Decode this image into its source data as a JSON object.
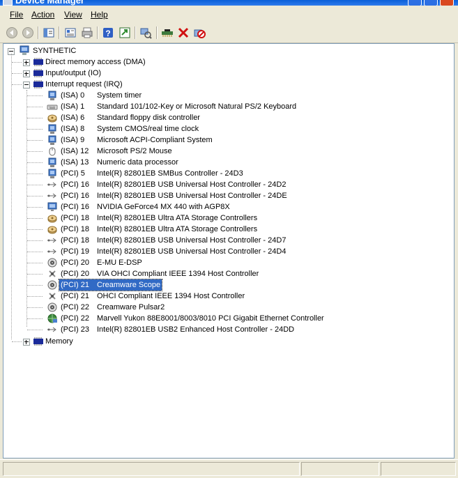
{
  "window": {
    "title": "Device Manager"
  },
  "menu": {
    "file": "File",
    "action": "Action",
    "view": "View",
    "help": "Help"
  },
  "tree": {
    "root": "SYNTHETIC",
    "dma": "Direct memory access (DMA)",
    "io": "Input/output (IO)",
    "irq": "Interrupt request (IRQ)",
    "memory": "Memory",
    "irq_items": [
      {
        "bus": "(ISA)",
        "num": "0",
        "name": "System timer"
      },
      {
        "bus": "(ISA)",
        "num": "1",
        "name": "Standard 101/102-Key or Microsoft Natural PS/2 Keyboard"
      },
      {
        "bus": "(ISA)",
        "num": "6",
        "name": "Standard floppy disk controller"
      },
      {
        "bus": "(ISA)",
        "num": "8",
        "name": "System CMOS/real time clock"
      },
      {
        "bus": "(ISA)",
        "num": "9",
        "name": "Microsoft ACPI-Compliant System"
      },
      {
        "bus": "(ISA)",
        "num": "12",
        "name": "Microsoft PS/2 Mouse"
      },
      {
        "bus": "(ISA)",
        "num": "13",
        "name": "Numeric data processor"
      },
      {
        "bus": "(PCI)",
        "num": "5",
        "name": "Intel(R) 82801EB SMBus Controller - 24D3"
      },
      {
        "bus": "(PCI)",
        "num": "16",
        "name": "Intel(R) 82801EB USB Universal Host Controller - 24D2"
      },
      {
        "bus": "(PCI)",
        "num": "16",
        "name": "Intel(R) 82801EB USB Universal Host Controller - 24DE"
      },
      {
        "bus": "(PCI)",
        "num": "16",
        "name": "NVIDIA GeForce4 MX 440 with AGP8X"
      },
      {
        "bus": "(PCI)",
        "num": "18",
        "name": "Intel(R) 82801EB Ultra ATA Storage Controllers"
      },
      {
        "bus": "(PCI)",
        "num": "18",
        "name": "Intel(R) 82801EB Ultra ATA Storage Controllers"
      },
      {
        "bus": "(PCI)",
        "num": "18",
        "name": "Intel(R) 82801EB USB Universal Host Controller - 24D7"
      },
      {
        "bus": "(PCI)",
        "num": "19",
        "name": "Intel(R) 82801EB USB Universal Host Controller - 24D4"
      },
      {
        "bus": "(PCI)",
        "num": "20",
        "name": "E-MU E-DSP"
      },
      {
        "bus": "(PCI)",
        "num": "20",
        "name": "VIA OHCI Compliant IEEE 1394 Host Controller"
      },
      {
        "bus": "(PCI)",
        "num": "21",
        "name": "Creamware Scope"
      },
      {
        "bus": "(PCI)",
        "num": "21",
        "name": "OHCI Compliant IEEE 1394 Host Controller"
      },
      {
        "bus": "(PCI)",
        "num": "22",
        "name": "Creamware Pulsar2"
      },
      {
        "bus": "(PCI)",
        "num": "22",
        "name": "Marvell Yukon 88E8001/8003/8010 PCI Gigabit Ethernet Controller"
      },
      {
        "bus": "(PCI)",
        "num": "23",
        "name": "Intel(R) 82801EB USB2 Enhanced Host Controller - 24DD"
      }
    ],
    "irq_icons": [
      "system-device-icon",
      "keyboard-icon",
      "disk-controller-icon",
      "system-device-icon",
      "system-device-icon",
      "mouse-icon",
      "system-device-icon",
      "system-device-icon",
      "usb-icon",
      "usb-icon",
      "display-icon",
      "disk-controller-icon",
      "disk-controller-icon",
      "usb-icon",
      "usb-icon",
      "sound-icon",
      "ieee1394-icon",
      "sound-icon",
      "ieee1394-icon",
      "sound-icon",
      "network-icon",
      "usb-icon"
    ],
    "selected_index": 17
  },
  "colors": {
    "selection": "#316ac5",
    "title_blue": "#0a5fd8",
    "chrome": "#ece9d8"
  }
}
